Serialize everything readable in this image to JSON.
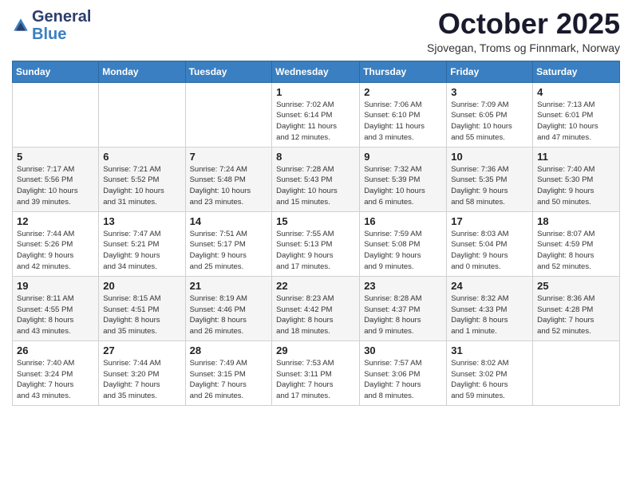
{
  "header": {
    "logo": {
      "general": "General",
      "blue": "Blue"
    },
    "title": "October 2025",
    "subtitle": "Sjovegan, Troms og Finnmark, Norway"
  },
  "days_of_week": [
    "Sunday",
    "Monday",
    "Tuesday",
    "Wednesday",
    "Thursday",
    "Friday",
    "Saturday"
  ],
  "weeks": [
    {
      "row_alt": false,
      "days": [
        {
          "num": "",
          "info": ""
        },
        {
          "num": "",
          "info": ""
        },
        {
          "num": "",
          "info": ""
        },
        {
          "num": "1",
          "info": "Sunrise: 7:02 AM\nSunset: 6:14 PM\nDaylight: 11 hours\nand 12 minutes."
        },
        {
          "num": "2",
          "info": "Sunrise: 7:06 AM\nSunset: 6:10 PM\nDaylight: 11 hours\nand 3 minutes."
        },
        {
          "num": "3",
          "info": "Sunrise: 7:09 AM\nSunset: 6:05 PM\nDaylight: 10 hours\nand 55 minutes."
        },
        {
          "num": "4",
          "info": "Sunrise: 7:13 AM\nSunset: 6:01 PM\nDaylight: 10 hours\nand 47 minutes."
        }
      ]
    },
    {
      "row_alt": true,
      "days": [
        {
          "num": "5",
          "info": "Sunrise: 7:17 AM\nSunset: 5:56 PM\nDaylight: 10 hours\nand 39 minutes."
        },
        {
          "num": "6",
          "info": "Sunrise: 7:21 AM\nSunset: 5:52 PM\nDaylight: 10 hours\nand 31 minutes."
        },
        {
          "num": "7",
          "info": "Sunrise: 7:24 AM\nSunset: 5:48 PM\nDaylight: 10 hours\nand 23 minutes."
        },
        {
          "num": "8",
          "info": "Sunrise: 7:28 AM\nSunset: 5:43 PM\nDaylight: 10 hours\nand 15 minutes."
        },
        {
          "num": "9",
          "info": "Sunrise: 7:32 AM\nSunset: 5:39 PM\nDaylight: 10 hours\nand 6 minutes."
        },
        {
          "num": "10",
          "info": "Sunrise: 7:36 AM\nSunset: 5:35 PM\nDaylight: 9 hours\nand 58 minutes."
        },
        {
          "num": "11",
          "info": "Sunrise: 7:40 AM\nSunset: 5:30 PM\nDaylight: 9 hours\nand 50 minutes."
        }
      ]
    },
    {
      "row_alt": false,
      "days": [
        {
          "num": "12",
          "info": "Sunrise: 7:44 AM\nSunset: 5:26 PM\nDaylight: 9 hours\nand 42 minutes."
        },
        {
          "num": "13",
          "info": "Sunrise: 7:47 AM\nSunset: 5:21 PM\nDaylight: 9 hours\nand 34 minutes."
        },
        {
          "num": "14",
          "info": "Sunrise: 7:51 AM\nSunset: 5:17 PM\nDaylight: 9 hours\nand 25 minutes."
        },
        {
          "num": "15",
          "info": "Sunrise: 7:55 AM\nSunset: 5:13 PM\nDaylight: 9 hours\nand 17 minutes."
        },
        {
          "num": "16",
          "info": "Sunrise: 7:59 AM\nSunset: 5:08 PM\nDaylight: 9 hours\nand 9 minutes."
        },
        {
          "num": "17",
          "info": "Sunrise: 8:03 AM\nSunset: 5:04 PM\nDaylight: 9 hours\nand 0 minutes."
        },
        {
          "num": "18",
          "info": "Sunrise: 8:07 AM\nSunset: 4:59 PM\nDaylight: 8 hours\nand 52 minutes."
        }
      ]
    },
    {
      "row_alt": true,
      "days": [
        {
          "num": "19",
          "info": "Sunrise: 8:11 AM\nSunset: 4:55 PM\nDaylight: 8 hours\nand 43 minutes."
        },
        {
          "num": "20",
          "info": "Sunrise: 8:15 AM\nSunset: 4:51 PM\nDaylight: 8 hours\nand 35 minutes."
        },
        {
          "num": "21",
          "info": "Sunrise: 8:19 AM\nSunset: 4:46 PM\nDaylight: 8 hours\nand 26 minutes."
        },
        {
          "num": "22",
          "info": "Sunrise: 8:23 AM\nSunset: 4:42 PM\nDaylight: 8 hours\nand 18 minutes."
        },
        {
          "num": "23",
          "info": "Sunrise: 8:28 AM\nSunset: 4:37 PM\nDaylight: 8 hours\nand 9 minutes."
        },
        {
          "num": "24",
          "info": "Sunrise: 8:32 AM\nSunset: 4:33 PM\nDaylight: 8 hours\nand 1 minute."
        },
        {
          "num": "25",
          "info": "Sunrise: 8:36 AM\nSunset: 4:28 PM\nDaylight: 7 hours\nand 52 minutes."
        }
      ]
    },
    {
      "row_alt": false,
      "days": [
        {
          "num": "26",
          "info": "Sunrise: 7:40 AM\nSunset: 3:24 PM\nDaylight: 7 hours\nand 43 minutes."
        },
        {
          "num": "27",
          "info": "Sunrise: 7:44 AM\nSunset: 3:20 PM\nDaylight: 7 hours\nand 35 minutes."
        },
        {
          "num": "28",
          "info": "Sunrise: 7:49 AM\nSunset: 3:15 PM\nDaylight: 7 hours\nand 26 minutes."
        },
        {
          "num": "29",
          "info": "Sunrise: 7:53 AM\nSunset: 3:11 PM\nDaylight: 7 hours\nand 17 minutes."
        },
        {
          "num": "30",
          "info": "Sunrise: 7:57 AM\nSunset: 3:06 PM\nDaylight: 7 hours\nand 8 minutes."
        },
        {
          "num": "31",
          "info": "Sunrise: 8:02 AM\nSunset: 3:02 PM\nDaylight: 6 hours\nand 59 minutes."
        },
        {
          "num": "",
          "info": ""
        }
      ]
    }
  ]
}
